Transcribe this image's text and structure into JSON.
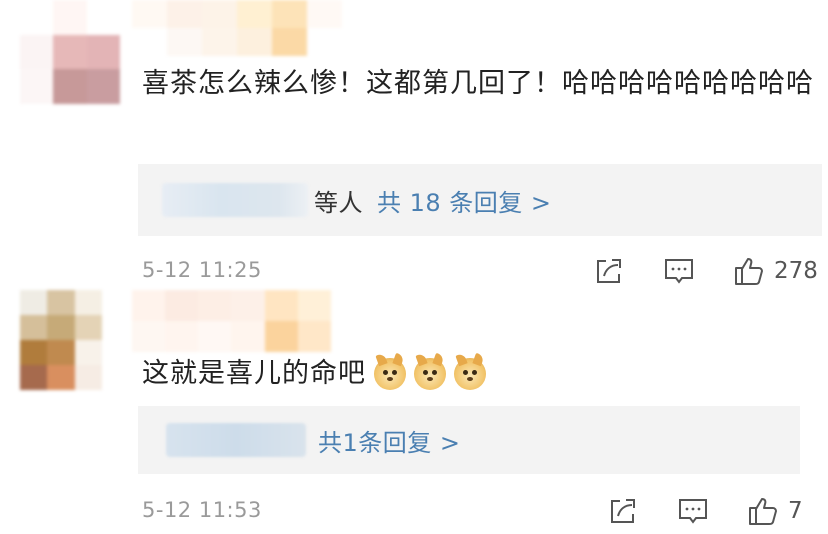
{
  "colors": {
    "link": "#4a7fb1",
    "reply_bg": "#f3f3f3",
    "meta_text": "#9a9a9a",
    "body_text": "#222222"
  },
  "comments": [
    {
      "text": "喜茶怎么辣么惨！这都第几回了！哈哈哈哈哈哈哈哈哈",
      "reply_suffix": "等人",
      "reply_link": "共 18 条回复 >",
      "time": "5-12 11:25",
      "likes": "278",
      "icons": [
        "share-icon",
        "comment-icon",
        "like-icon"
      ]
    },
    {
      "text": "这就是喜儿的命吧",
      "emoji": [
        "doge-emoji",
        "doge-emoji",
        "doge-emoji"
      ],
      "reply_link": "共1条回复 >",
      "time": "5-12 11:53",
      "likes": "7",
      "icons": [
        "share-icon",
        "comment-icon",
        "like-icon"
      ]
    }
  ]
}
